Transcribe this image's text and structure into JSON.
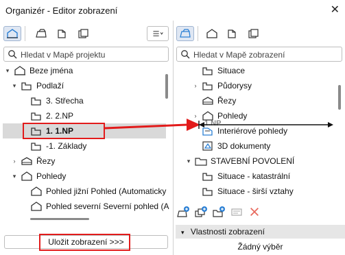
{
  "window": {
    "title": "Organizér - Editor zobrazení",
    "close_glyph": "✕"
  },
  "left": {
    "search_placeholder": "Hledat v Mapě projektu",
    "tree": [
      {
        "label": "Beze jména",
        "icon": "house-icon",
        "arrow": "▾"
      },
      {
        "label": "Podlaží",
        "icon": "floor-icon",
        "arrow": "▾"
      },
      {
        "label": "3. Střecha",
        "icon": "floor-icon",
        "arrow": ""
      },
      {
        "label": "2. 2.NP",
        "icon": "floor-icon",
        "arrow": ""
      },
      {
        "label": "1. 1.NP",
        "icon": "floor-icon",
        "arrow": ""
      },
      {
        "label": "-1. Základy",
        "icon": "floor-icon",
        "arrow": ""
      },
      {
        "label": "Řezy",
        "icon": "section-icon",
        "arrow": "›"
      },
      {
        "label": "Pohledy",
        "icon": "elevation-icon",
        "arrow": "▾"
      },
      {
        "label": "Pohled jižní Pohled (Automaticky",
        "icon": "elevation-icon",
        "arrow": ""
      },
      {
        "label": "Pohled severní Severní pohled (A",
        "icon": "elevation-icon",
        "arrow": ""
      }
    ],
    "save_button": "Uložit zobrazení >>>"
  },
  "right": {
    "search_placeholder": "Hledat v Mapě zobrazení",
    "tree": [
      {
        "label": "Situace",
        "icon": "floor-icon",
        "arrow": ""
      },
      {
        "label": "Půdorysy",
        "icon": "floor-icon",
        "arrow": "›"
      },
      {
        "label": "Řezy",
        "icon": "section-icon",
        "arrow": ""
      },
      {
        "label": "Pohledy",
        "icon": "elevation-icon",
        "arrow": "›"
      },
      {
        "label": "Interiérové pohledy",
        "icon": "interior-icon",
        "arrow": ""
      },
      {
        "label": "3D dokumenty",
        "icon": "3d-doc-icon",
        "arrow": ""
      },
      {
        "label": "STAVEBNÍ POVOLENÍ",
        "icon": "folder-icon",
        "arrow": "▾"
      },
      {
        "label": "Situace - katastrální",
        "icon": "floor-icon",
        "arrow": ""
      },
      {
        "label": "Situace - širší vztahy",
        "icon": "floor-icon",
        "arrow": ""
      }
    ],
    "drag_ghost": "1.NP",
    "props_header": "Vlastnosti zobrazení",
    "props_header_arrow": "▾",
    "props_body": "Žádný výběr"
  },
  "colors": {
    "annotation": "#e21b1b",
    "selection": "#d9d9d9",
    "icon_blue": "#2a7fd4"
  }
}
